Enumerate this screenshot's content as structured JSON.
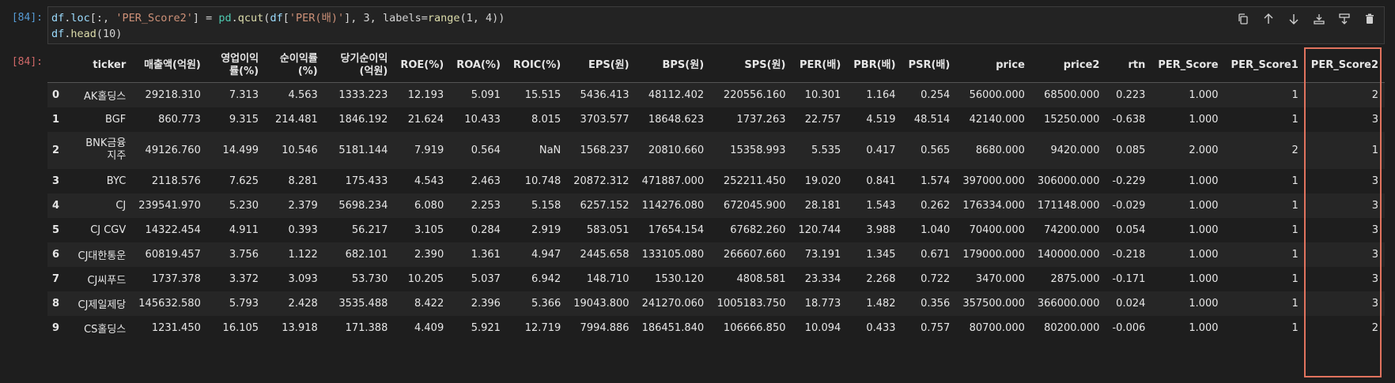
{
  "cell": {
    "in_prompt": "[84]:",
    "out_prompt": "[84]:",
    "code_line1": {
      "a": "df",
      "b": ".",
      "c": "loc",
      "d": "[:, ",
      "e": "'PER_Score2'",
      "f": "] = ",
      "g": "pd",
      "h": ".",
      "i": "qcut",
      "j": "(",
      "k": "df",
      "l": "[",
      "m": "'PER(배)'",
      "n": "], 3, labels=",
      "o": "range",
      "p": "(1, 4))"
    },
    "code_line2": {
      "a": "df",
      "b": ".",
      "c": "head",
      "d": "(10)"
    }
  },
  "toolbar": {
    "icons": [
      "duplicate-icon",
      "move-up-icon",
      "move-down-icon",
      "insert-below-icon",
      "split-cell-icon",
      "delete-icon"
    ]
  },
  "table": {
    "columns": [
      "ticker",
      "매출액(억원)",
      "영업이익률(%)",
      "순이익률(%)",
      "당기순이익(억원)",
      "ROE(%)",
      "ROA(%)",
      "ROIC(%)",
      "EPS(원)",
      "BPS(원)",
      "SPS(원)",
      "PER(배)",
      "PBR(배)",
      "PSR(배)",
      "price",
      "price2",
      "rtn",
      "PER_Score",
      "PER_Score1",
      "PER_Score2"
    ],
    "rows": [
      {
        "idx": "0",
        "cells": [
          "AK홀딩스",
          "29218.310",
          "7.313",
          "4.563",
          "1333.223",
          "12.193",
          "5.091",
          "15.515",
          "5436.413",
          "48112.402",
          "220556.160",
          "10.301",
          "1.164",
          "0.254",
          "56000.000",
          "68500.000",
          "0.223",
          "1.000",
          "1",
          "2"
        ]
      },
      {
        "idx": "1",
        "cells": [
          "BGF",
          "860.773",
          "9.315",
          "214.481",
          "1846.192",
          "21.624",
          "10.433",
          "8.015",
          "3703.577",
          "18648.623",
          "1737.263",
          "22.757",
          "4.519",
          "48.514",
          "42140.000",
          "15250.000",
          "-0.638",
          "1.000",
          "1",
          "3"
        ]
      },
      {
        "idx": "2",
        "cells": [
          "BNK금융지주",
          "49126.760",
          "14.499",
          "10.546",
          "5181.144",
          "7.919",
          "0.564",
          "NaN",
          "1568.237",
          "20810.660",
          "15358.993",
          "5.535",
          "0.417",
          "0.565",
          "8680.000",
          "9420.000",
          "0.085",
          "2.000",
          "2",
          "1"
        ]
      },
      {
        "idx": "3",
        "cells": [
          "BYC",
          "2118.576",
          "7.625",
          "8.281",
          "175.433",
          "4.543",
          "2.463",
          "10.748",
          "20872.312",
          "471887.000",
          "252211.450",
          "19.020",
          "0.841",
          "1.574",
          "397000.000",
          "306000.000",
          "-0.229",
          "1.000",
          "1",
          "3"
        ]
      },
      {
        "idx": "4",
        "cells": [
          "CJ",
          "239541.970",
          "5.230",
          "2.379",
          "5698.234",
          "6.080",
          "2.253",
          "5.158",
          "6257.152",
          "114276.080",
          "672045.900",
          "28.181",
          "1.543",
          "0.262",
          "176334.000",
          "171148.000",
          "-0.029",
          "1.000",
          "1",
          "3"
        ]
      },
      {
        "idx": "5",
        "cells": [
          "CJ CGV",
          "14322.454",
          "4.911",
          "0.393",
          "56.217",
          "3.105",
          "0.284",
          "2.919",
          "583.051",
          "17654.154",
          "67682.260",
          "120.744",
          "3.988",
          "1.040",
          "70400.000",
          "74200.000",
          "0.054",
          "1.000",
          "1",
          "3"
        ]
      },
      {
        "idx": "6",
        "cells": [
          "CJ대한통운",
          "60819.457",
          "3.756",
          "1.122",
          "682.101",
          "2.390",
          "1.361",
          "4.947",
          "2445.658",
          "133105.080",
          "266607.660",
          "73.191",
          "1.345",
          "0.671",
          "179000.000",
          "140000.000",
          "-0.218",
          "1.000",
          "1",
          "3"
        ]
      },
      {
        "idx": "7",
        "cells": [
          "CJ씨푸드",
          "1737.378",
          "3.372",
          "3.093",
          "53.730",
          "10.205",
          "5.037",
          "6.942",
          "148.710",
          "1530.120",
          "4808.581",
          "23.334",
          "2.268",
          "0.722",
          "3470.000",
          "2875.000",
          "-0.171",
          "1.000",
          "1",
          "3"
        ]
      },
      {
        "idx": "8",
        "cells": [
          "CJ제일제당",
          "145632.580",
          "5.793",
          "2.428",
          "3535.488",
          "8.422",
          "2.396",
          "5.366",
          "19043.800",
          "241270.060",
          "1005183.750",
          "18.773",
          "1.482",
          "0.356",
          "357500.000",
          "366000.000",
          "0.024",
          "1.000",
          "1",
          "3"
        ]
      },
      {
        "idx": "9",
        "cells": [
          "CS홀딩스",
          "1231.450",
          "16.105",
          "13.918",
          "171.388",
          "4.409",
          "5.921",
          "12.719",
          "7994.886",
          "186451.840",
          "106666.850",
          "10.094",
          "0.433",
          "0.757",
          "80700.000",
          "80200.000",
          "-0.006",
          "1.000",
          "1",
          "2"
        ]
      }
    ]
  },
  "colors": {
    "highlight_border": "#e1735e",
    "in_prompt": "#569cd6",
    "out_prompt": "#d16969"
  }
}
